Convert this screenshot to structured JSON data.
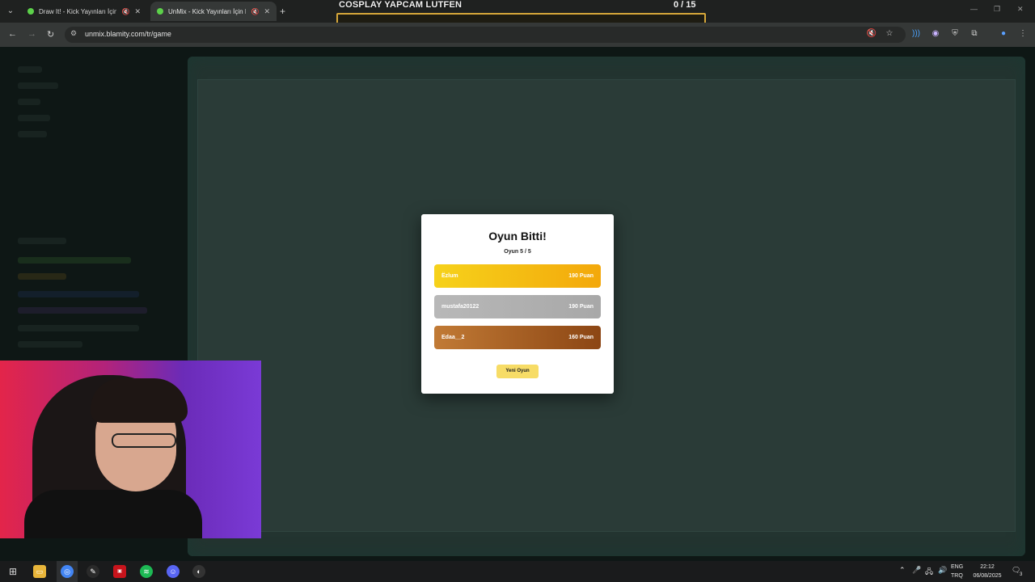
{
  "browser": {
    "tabs": [
      {
        "title": "Draw It! - Kick Yayınları İçin",
        "active": false
      },
      {
        "title": "UnMix - Kick Yayınları İçin K",
        "active": true
      }
    ],
    "url": "unmix.blamity.com/tr/game"
  },
  "stream_overlay": {
    "title": "COSPLAY YAPCAM LUTFEN",
    "count": "0  / 15"
  },
  "modal": {
    "title": "Oyun Bitti!",
    "subtitle": "Oyun 5 / 5",
    "players": [
      {
        "name": "Ёzlum",
        "score": "190 Puan",
        "medal": "gold"
      },
      {
        "name": "mustafa20122",
        "score": "190 Puan",
        "medal": "silver"
      },
      {
        "name": "Edaa__2",
        "score": "160 Puan",
        "medal": "bronze"
      }
    ],
    "new_game_label": "Yeni Oyun"
  },
  "taskbar": {
    "lang_top": "ENG",
    "lang_bottom": "TRQ",
    "time": "22:12",
    "date": "06/08/2025",
    "notifications": "3"
  },
  "colors": {
    "gold": "#f6d21b",
    "silver": "#b8b8b8",
    "bronze": "#a85f25",
    "button": "#f7dc66",
    "overlay_border": "#d6a73a"
  }
}
